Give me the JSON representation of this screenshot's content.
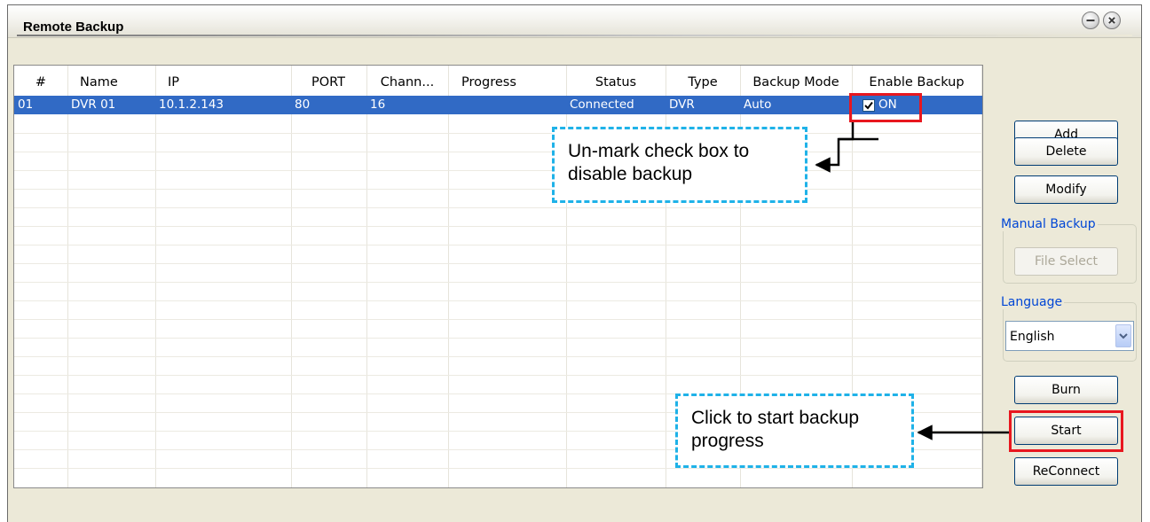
{
  "window": {
    "title": "Remote Backup"
  },
  "table": {
    "columns": [
      "#",
      "Name",
      "IP",
      "PORT",
      "Chann...",
      "Progress",
      "Status",
      "Type",
      "Backup Mode",
      "Enable Backup"
    ],
    "rows": [
      {
        "num": "01",
        "name": "DVR 01",
        "ip": "10.1.2.143",
        "port": "80",
        "channels": "16",
        "progress": "",
        "status": "Connected",
        "type": "DVR",
        "backup_mode": "Auto",
        "enable_backup": true,
        "enable_label": "ON"
      }
    ]
  },
  "buttons": {
    "add": "Add",
    "delete": "Delete",
    "modify": "Modify",
    "file_select": "File Select",
    "burn": "Burn",
    "start": "Start",
    "reconnect": "ReConnect"
  },
  "manual_backup": {
    "label": "Manual Backup"
  },
  "language": {
    "label": "Language",
    "selected": "English"
  },
  "annotations": {
    "checkbox_note": [
      "Un-mark check box to",
      "disable backup"
    ],
    "start_note": [
      "Click to start backup",
      "progress"
    ]
  },
  "colors": {
    "selection": "#316ac5",
    "highlight_box": "#e8171f",
    "callout_border": "#1fb2e8",
    "group_label": "#0046d5"
  },
  "icons": [
    "minimize-icon",
    "close-icon",
    "checkmark-icon",
    "dropdown-arrow-icon"
  ]
}
